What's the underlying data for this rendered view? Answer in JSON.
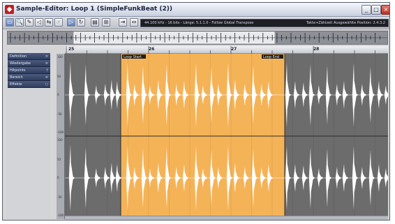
{
  "window": {
    "title": "Sample-Editor: Loop 1 (SimpleFunkBeat (2))",
    "app_icon": "cubase-icon",
    "controls": {
      "minimize": "_",
      "maximize": "□",
      "close": "×"
    }
  },
  "toolbar": {
    "tools": [
      {
        "icon": "range-select-icon",
        "glyph": "▭"
      },
      {
        "icon": "zoom-icon",
        "glyph": "🔍"
      },
      {
        "icon": "pencil-icon",
        "glyph": "✎"
      },
      {
        "icon": "speaker-icon",
        "glyph": "◁"
      },
      {
        "icon": "scrub-icon",
        "glyph": "⇆"
      },
      {
        "icon": "hand-icon",
        "glyph": "☞"
      },
      {
        "icon": "play-icon",
        "glyph": "▷"
      },
      {
        "icon": "loop-icon",
        "glyph": "↻"
      },
      {
        "icon": "snap-icon",
        "glyph": "▤"
      },
      {
        "icon": "grid-icon",
        "glyph": "⊞"
      },
      {
        "icon": "hitpoint-icon",
        "glyph": "⇥"
      },
      {
        "icon": "warp-icon",
        "glyph": "⇔"
      },
      {
        "icon": "edit-icon",
        "glyph": "↖"
      }
    ],
    "info": "44.100 kHz - 16 bits - Länge: 5.1.1.0 - Follow Global Transpose",
    "info_right": "Takte+Zählzeit   Ausgewählte Position: 2.4.3.2"
  },
  "left_panel": {
    "items": [
      {
        "label": "Definition",
        "icon": "≡"
      },
      {
        "label": "Wiedergabe",
        "icon": "≡"
      },
      {
        "label": "Hitpoints",
        "icon": "†"
      },
      {
        "label": "Bereich",
        "icon": "≡"
      },
      {
        "label": "Effekte",
        "icon": "○"
      }
    ]
  },
  "ruler": {
    "labels": [
      "25",
      "26",
      "27",
      "28"
    ]
  },
  "scale": {
    "labels": [
      "100",
      "50",
      "0",
      "-50",
      "-100",
      "100",
      "50",
      "0",
      "-50",
      "-100"
    ]
  },
  "selection": {
    "start_label": "Loop Start",
    "end_label": "Loop End"
  }
}
